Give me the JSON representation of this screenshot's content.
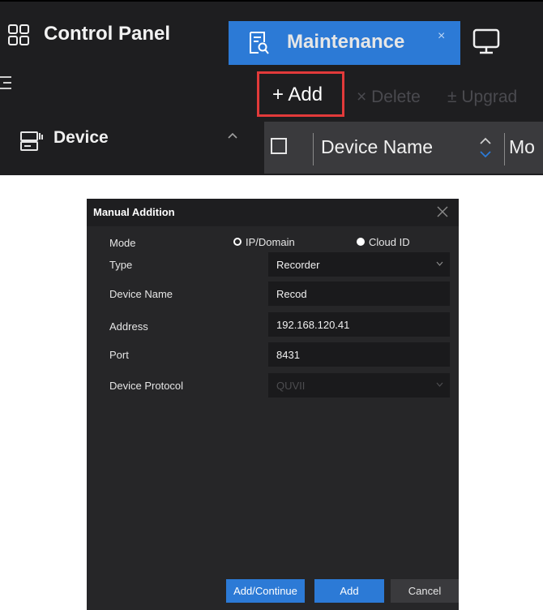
{
  "tabs": {
    "control_panel": "Control Panel",
    "maintenance": "Maintenance",
    "close_glyph": "×"
  },
  "sidebar": {
    "device_label": "Device"
  },
  "toolbar": {
    "add_label": "+ Add",
    "delete_label": "× Delete",
    "upgrade_label": "± Upgrad"
  },
  "table": {
    "col_device_name": "Device Name",
    "col_next": "Mo"
  },
  "dialog": {
    "title": "Manual Addition",
    "mode_label": "Mode",
    "mode_options": [
      "IP/Domain",
      "Cloud ID"
    ],
    "fields": {
      "type": {
        "label": "Type",
        "value": "Recorder"
      },
      "device_name": {
        "label": "Device Name",
        "value": "Recod"
      },
      "address": {
        "label": "Address",
        "value": "192.168.120.41"
      },
      "port": {
        "label": "Port",
        "value": "8431"
      },
      "protocol": {
        "label": "Device Protocol",
        "value": "QUVII"
      }
    },
    "buttons": {
      "add_continue": "Add/Continue",
      "add": "Add",
      "cancel": "Cancel"
    }
  },
  "colors": {
    "accent": "#2c7ad6",
    "highlight_border": "#e23a3a",
    "panel_bg": "#1e1e20",
    "dialog_bg": "#262628"
  }
}
